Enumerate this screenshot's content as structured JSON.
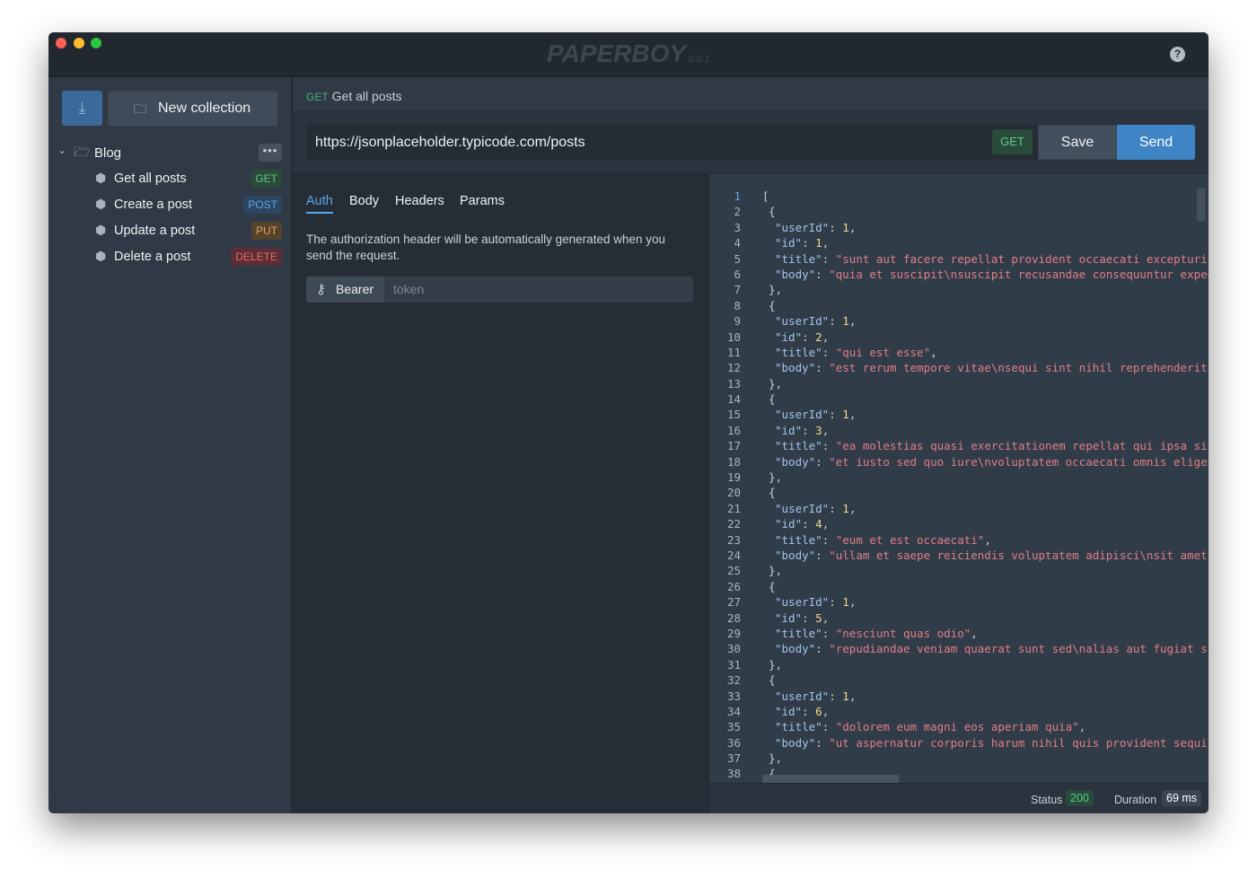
{
  "app": {
    "name": "PAPERBOY",
    "version": "0.0.1"
  },
  "colors": {
    "accent": "#3f84c5",
    "get": "#48b07a",
    "post": "#5aa6ea",
    "put": "#d7a050",
    "delete": "#e05a5a"
  },
  "sidebar": {
    "import_icon": "download-icon",
    "new_collection": "New collection",
    "collection": {
      "name": "Blog",
      "expanded": true,
      "requests": [
        {
          "label": "Get all posts",
          "method": "GET",
          "active": true
        },
        {
          "label": "Create a post",
          "method": "POST"
        },
        {
          "label": "Update a post",
          "method": "PUT"
        },
        {
          "label": "Delete a post",
          "method": "DELETE"
        }
      ]
    }
  },
  "request": {
    "method": "GET",
    "name": "Get all posts",
    "url": "https://jsonplaceholder.typicode.com/posts",
    "save": "Save",
    "send": "Send",
    "tabs": [
      "Auth",
      "Body",
      "Headers",
      "Params"
    ],
    "active_tab": "Auth",
    "auth": {
      "note": "The authorization header will be automatically generated when you send the request.",
      "type": "Bearer",
      "token_placeholder": "token"
    }
  },
  "response": {
    "lines": [
      "[",
      "{",
      "\"userId\": 1,",
      "\"id\": 1,",
      "\"title\": \"sunt aut facere repellat provident occaecati excepturi optio reprehenderit\",",
      "\"body\": \"quia et suscipit\\nsuscipit recusandae consequuntur expedita et cum\"",
      "},",
      "{",
      "\"userId\": 1,",
      "\"id\": 2,",
      "\"title\": \"qui est esse\",",
      "\"body\": \"est rerum tempore vitae\\nsequi sint nihil reprehenderit dolor beatae\"",
      "},",
      "{",
      "\"userId\": 1,",
      "\"id\": 3,",
      "\"title\": \"ea molestias quasi exercitationem repellat qui ipsa sit aut\",",
      "\"body\": \"et iusto sed quo iure\\nvoluptatem occaecati omnis eligendi aut ad\"",
      "},",
      "{",
      "\"userId\": 1,",
      "\"id\": 4,",
      "\"title\": \"eum et est occaecati\",",
      "\"body\": \"ullam et saepe reiciendis voluptatem adipisci\\nsit amet autem assumenda\"",
      "},",
      "{",
      "\"userId\": 1,",
      "\"id\": 5,",
      "\"title\": \"nesciunt quas odio\",",
      "\"body\": \"repudiandae veniam quaerat sunt sed\\nalias aut fugiat sit autem sed est\"",
      "},",
      "{",
      "\"userId\": 1,",
      "\"id\": 6,",
      "\"title\": \"dolorem eum magni eos aperiam quia\",",
      "\"body\": \"ut aspernatur corporis harum nihil quis provident sequi\\nmollitia nobis\"",
      "},",
      "{"
    ],
    "status_label": "Status",
    "status": "200",
    "duration_label": "Duration",
    "duration": "69 ms"
  }
}
